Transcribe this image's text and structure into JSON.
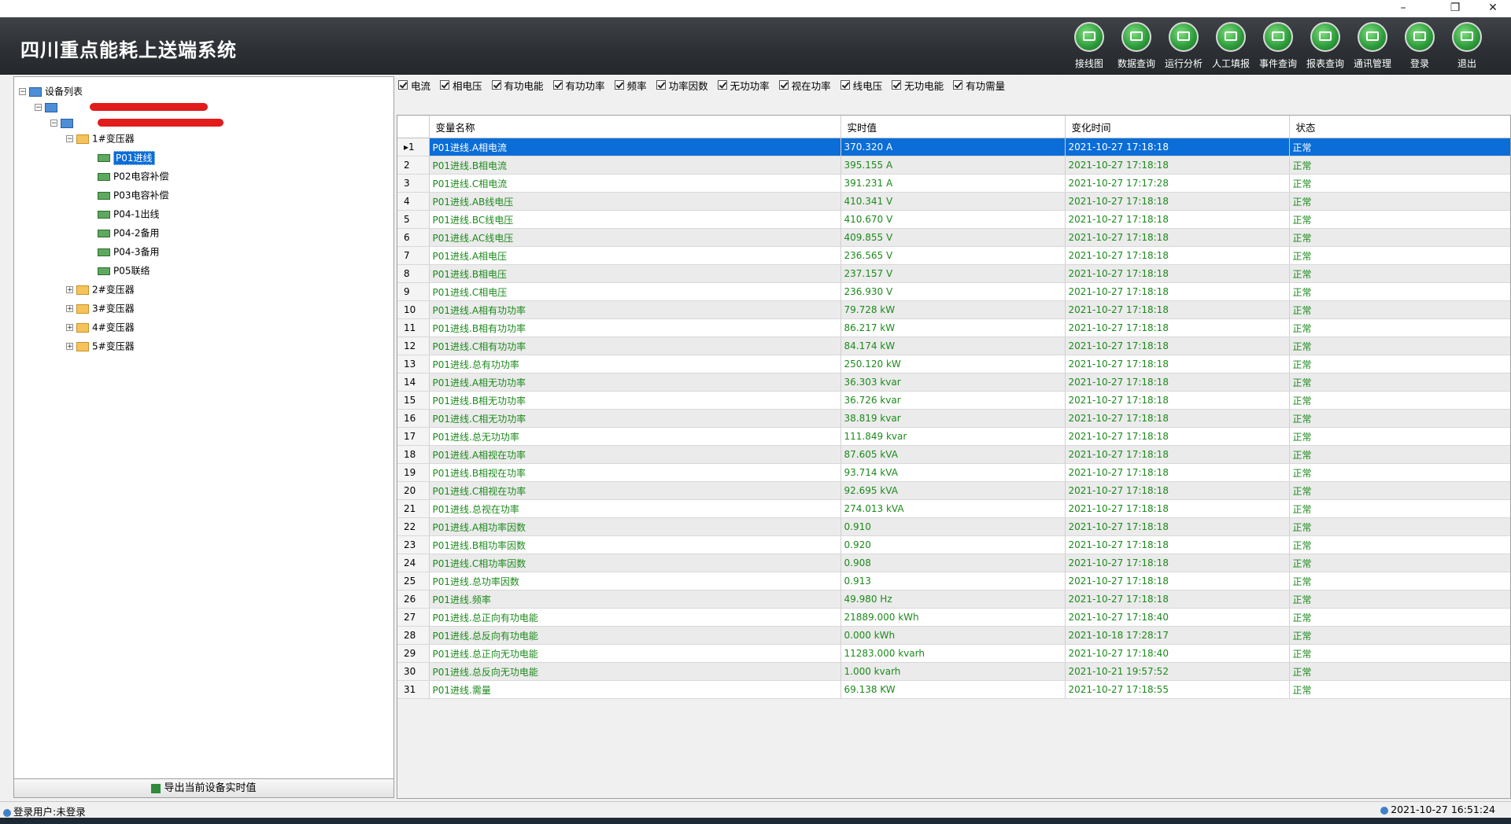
{
  "window": {
    "restore_glyph": "❐",
    "close_glyph": "✕"
  },
  "app_title": "四川重点能耗上送端系统",
  "toolbar": [
    {
      "label": "接线图",
      "icon": "wiring-icon"
    },
    {
      "label": "数据查询",
      "icon": "data-query-icon"
    },
    {
      "label": "运行分析",
      "icon": "analysis-icon"
    },
    {
      "label": "人工填报",
      "icon": "manual-entry-icon"
    },
    {
      "label": "事件查询",
      "icon": "event-query-icon"
    },
    {
      "label": "报表查询",
      "icon": "report-query-icon"
    },
    {
      "label": "通讯管理",
      "icon": "comm-manage-icon"
    },
    {
      "label": "登录",
      "icon": "login-icon"
    },
    {
      "label": "退出",
      "icon": "exit-icon"
    }
  ],
  "tree": {
    "root": "设备列表",
    "transformers": [
      "1#变压器",
      "2#变压器",
      "3#变压器",
      "4#变压器",
      "5#变压器"
    ],
    "feeders": [
      "P01进线",
      "P02电容补偿",
      "P03电容补偿",
      "P04-1出线",
      "P04-2备用",
      "P04-3备用",
      "P05联络"
    ]
  },
  "export_button": "导出当前设备实时值",
  "filters": [
    "电流",
    "相电压",
    "有功电能",
    "有功功率",
    "频率",
    "功率因数",
    "无功功率",
    "视在功率",
    "线电压",
    "无功电能",
    "有功需量"
  ],
  "grid": {
    "columns": [
      "变量名称",
      "实时值",
      "变化时间",
      "状态"
    ],
    "rows": [
      [
        "1",
        "P01进线.A相电流",
        "370.320 A",
        "2021-10-27 17:18:18",
        "正常"
      ],
      [
        "2",
        "P01进线.B相电流",
        "395.155 A",
        "2021-10-27 17:18:18",
        "正常"
      ],
      [
        "3",
        "P01进线.C相电流",
        "391.231 A",
        "2021-10-27 17:17:28",
        "正常"
      ],
      [
        "4",
        "P01进线.AB线电压",
        "410.341 V",
        "2021-10-27 17:18:18",
        "正常"
      ],
      [
        "5",
        "P01进线.BC线电压",
        "410.670 V",
        "2021-10-27 17:18:18",
        "正常"
      ],
      [
        "6",
        "P01进线.AC线电压",
        "409.855 V",
        "2021-10-27 17:18:18",
        "正常"
      ],
      [
        "7",
        "P01进线.A相电压",
        "236.565 V",
        "2021-10-27 17:18:18",
        "正常"
      ],
      [
        "8",
        "P01进线.B相电压",
        "237.157 V",
        "2021-10-27 17:18:18",
        "正常"
      ],
      [
        "9",
        "P01进线.C相电压",
        "236.930 V",
        "2021-10-27 17:18:18",
        "正常"
      ],
      [
        "10",
        "P01进线.A相有功功率",
        "79.728 kW",
        "2021-10-27 17:18:18",
        "正常"
      ],
      [
        "11",
        "P01进线.B相有功功率",
        "86.217 kW",
        "2021-10-27 17:18:18",
        "正常"
      ],
      [
        "12",
        "P01进线.C相有功功率",
        "84.174 kW",
        "2021-10-27 17:18:18",
        "正常"
      ],
      [
        "13",
        "P01进线.总有功功率",
        "250.120 kW",
        "2021-10-27 17:18:18",
        "正常"
      ],
      [
        "14",
        "P01进线.A相无功功率",
        "36.303 kvar",
        "2021-10-27 17:18:18",
        "正常"
      ],
      [
        "15",
        "P01进线.B相无功功率",
        "36.726 kvar",
        "2021-10-27 17:18:18",
        "正常"
      ],
      [
        "16",
        "P01进线.C相无功功率",
        "38.819 kvar",
        "2021-10-27 17:18:18",
        "正常"
      ],
      [
        "17",
        "P01进线.总无功功率",
        "111.849 kvar",
        "2021-10-27 17:18:18",
        "正常"
      ],
      [
        "18",
        "P01进线.A相视在功率",
        "87.605 kVA",
        "2021-10-27 17:18:18",
        "正常"
      ],
      [
        "19",
        "P01进线.B相视在功率",
        "93.714 kVA",
        "2021-10-27 17:18:18",
        "正常"
      ],
      [
        "20",
        "P01进线.C相视在功率",
        "92.695 kVA",
        "2021-10-27 17:18:18",
        "正常"
      ],
      [
        "21",
        "P01进线.总视在功率",
        "274.013 kVA",
        "2021-10-27 17:18:18",
        "正常"
      ],
      [
        "22",
        "P01进线.A相功率因数",
        "0.910",
        "2021-10-27 17:18:18",
        "正常"
      ],
      [
        "23",
        "P01进线.B相功率因数",
        "0.920",
        "2021-10-27 17:18:18",
        "正常"
      ],
      [
        "24",
        "P01进线.C相功率因数",
        "0.908",
        "2021-10-27 17:18:18",
        "正常"
      ],
      [
        "25",
        "P01进线.总功率因数",
        "0.913",
        "2021-10-27 17:18:18",
        "正常"
      ],
      [
        "26",
        "P01进线.频率",
        "49.980 Hz",
        "2021-10-27 17:18:18",
        "正常"
      ],
      [
        "27",
        "P01进线.总正向有功电能",
        "21889.000 kWh",
        "2021-10-27 17:18:40",
        "正常"
      ],
      [
        "28",
        "P01进线.总反向有功电能",
        "0.000 kWh",
        "2021-10-18 17:28:17",
        "正常"
      ],
      [
        "29",
        "P01进线.总正向无功电能",
        "11283.000 kvarh",
        "2021-10-27 17:18:40",
        "正常"
      ],
      [
        "30",
        "P01进线.总反向无功电能",
        "1.000 kvarh",
        "2021-10-21 19:57:52",
        "正常"
      ],
      [
        "31",
        "P01进线.需量",
        "69.138 KW",
        "2021-10-27 17:18:55",
        "正常"
      ]
    ]
  },
  "status": {
    "user": "登录用户:未登录",
    "time": "2021-10-27 16:51:24"
  },
  "colors": {
    "selection": "#0a6dd8",
    "value_text": "#1c8a1c",
    "header_bg": "#2c2f33"
  }
}
